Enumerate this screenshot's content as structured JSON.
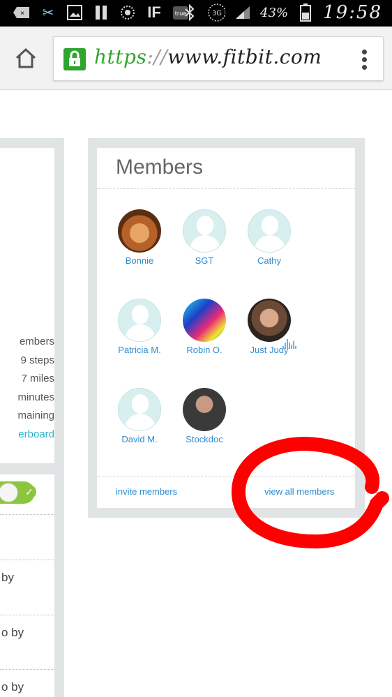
{
  "status_bar": {
    "battery": "43%",
    "time": "19:58",
    "network": "3G",
    "icons": [
      "message-icon",
      "scissors-icon",
      "gallery-icon",
      "pause-icon",
      "sync-icon",
      "ifttt-icon",
      "true-icon",
      "bluetooth-icon",
      "signal-icon",
      "battery-icon"
    ]
  },
  "browser": {
    "url_scheme": "https",
    "url_sep": "://",
    "url_host": "www.fitbit.com",
    "icons": [
      "home-icon",
      "lock-icon",
      "overflow-menu-icon"
    ]
  },
  "left_panel": {
    "stats": [
      "embers",
      "9 steps",
      "7 miles",
      "minutes",
      "maining",
      "erboard"
    ],
    "rows": [
      "by",
      "o by",
      "o by"
    ]
  },
  "members_panel": {
    "title": "Members",
    "members": [
      {
        "name": "Bonnie",
        "avatar": "cat-photo"
      },
      {
        "name": "SGT",
        "avatar": "default-avatar"
      },
      {
        "name": "Cathy",
        "avatar": "default-avatar"
      },
      {
        "name": "Patricia M.",
        "avatar": "default-avatar"
      },
      {
        "name": "Robin O.",
        "avatar": "colorful-photo"
      },
      {
        "name": "Just Judy",
        "avatar": "woman-photo"
      },
      {
        "name": "David M.",
        "avatar": "default-avatar"
      },
      {
        "name": "Stockdoc",
        "avatar": "man-photo"
      }
    ],
    "invite_label": "invite members",
    "view_all_label": "view all members"
  },
  "colors": {
    "link": "#2d8ccf",
    "accent_teal": "#2bb5c8",
    "secure_green": "#2fa52f",
    "toggle_green": "#8cc63f",
    "annotation_red": "#ff0000"
  }
}
